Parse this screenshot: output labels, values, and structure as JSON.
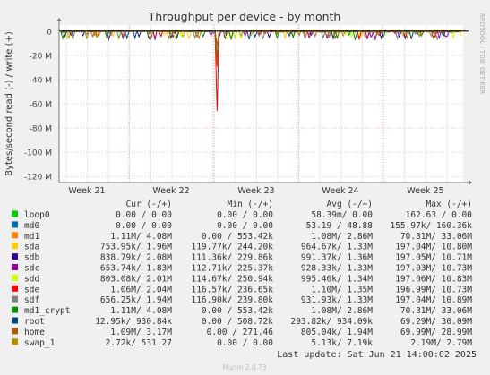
{
  "chart_data": {
    "type": "line",
    "title": "Throughput per device - by month",
    "ylabel": "Bytes/second read (-) / write (+)",
    "side_label": "RRDTOOL / TOBI OETIKER",
    "footer": "Munin 2.0.73",
    "last_update": "Last update: Sat Jun 21 14:00:02 2025",
    "ylim": [
      -125000000,
      5000000
    ],
    "y_ticks": [
      0,
      -20000000,
      -40000000,
      -60000000,
      -80000000,
      -100000000,
      -120000000
    ],
    "y_tick_labels": [
      "0",
      "-20 M",
      "-40 M",
      "-60 M",
      "-80 M",
      "-100 M",
      "-120 M"
    ],
    "x_ticks": [
      "Week 21",
      "Week 22",
      "Week 23",
      "Week 24",
      "Week 25"
    ],
    "legend_columns": [
      "Cur (-/+)",
      "Min (-/+)",
      "Avg (-/+)",
      "Max (-/+)"
    ],
    "series": [
      {
        "name": "loop0",
        "color": "#00cc00",
        "cur": "0.00 /   0.00",
        "min": "0.00 /   0.00",
        "avg": "58.39m/   0.00",
        "max": "162.63 /   0.00"
      },
      {
        "name": "md0",
        "color": "#0066b3",
        "cur": "0.00 /   0.00",
        "min": "0.00 /   0.00",
        "avg": "53.19 /  48.88",
        "max": "155.97k/ 160.36k"
      },
      {
        "name": "md1",
        "color": "#ff8000",
        "cur": "1.11M/   4.08M",
        "min": "0.00 / 553.42k",
        "avg": "1.08M/   2.86M",
        "max": "70.31M/  33.06M"
      },
      {
        "name": "sda",
        "color": "#ffcc00",
        "cur": "753.95k/   1.96M",
        "min": "119.77k/ 244.20k",
        "avg": "964.67k/   1.33M",
        "max": "197.04M/  10.80M"
      },
      {
        "name": "sdb",
        "color": "#330099",
        "cur": "838.79k/   2.08M",
        "min": "111.36k/ 229.86k",
        "avg": "991.37k/   1.36M",
        "max": "197.05M/  10.71M"
      },
      {
        "name": "sdc",
        "color": "#990099",
        "cur": "653.74k/   1.83M",
        "min": "112.71k/ 225.37k",
        "avg": "928.33k/   1.33M",
        "max": "197.03M/  10.73M"
      },
      {
        "name": "sdd",
        "color": "#ccff00",
        "cur": "803.08k/   2.01M",
        "min": "114.67k/ 250.94k",
        "avg": "995.46k/   1.34M",
        "max": "197.06M/  10.83M"
      },
      {
        "name": "sde",
        "color": "#ff0000",
        "cur": "1.06M/   2.04M",
        "min": "116.57k/ 236.65k",
        "avg": "1.10M/   1.35M",
        "max": "196.99M/  10.73M"
      },
      {
        "name": "sdf",
        "color": "#808080",
        "cur": "656.25k/   1.94M",
        "min": "116.90k/ 239.80k",
        "avg": "931.93k/   1.33M",
        "max": "197.04M/  10.89M"
      },
      {
        "name": "md1_crypt",
        "color": "#008f00",
        "cur": "1.11M/   4.08M",
        "min": "0.00 / 553.42k",
        "avg": "1.08M/   2.86M",
        "max": "70.31M/  33.06M"
      },
      {
        "name": "root",
        "color": "#00487d",
        "cur": "12.95k/ 930.84k",
        "min": "0.00 / 508.72k",
        "avg": "293.82k/ 934.09k",
        "max": "69.29M/  30.09M"
      },
      {
        "name": "home",
        "color": "#b35a00",
        "cur": "1.09M/   3.17M",
        "min": "0.00 / 271.46",
        "avg": "805.04k/   1.94M",
        "max": "69.99M/  28.99M"
      },
      {
        "name": "swap_1",
        "color": "#b38f00",
        "cur": "2.72k/ 531.27",
        "min": "0.00 /   0.00",
        "avg": "5.13k/   7.19k",
        "max": "2.19M/   2.79M"
      }
    ]
  }
}
